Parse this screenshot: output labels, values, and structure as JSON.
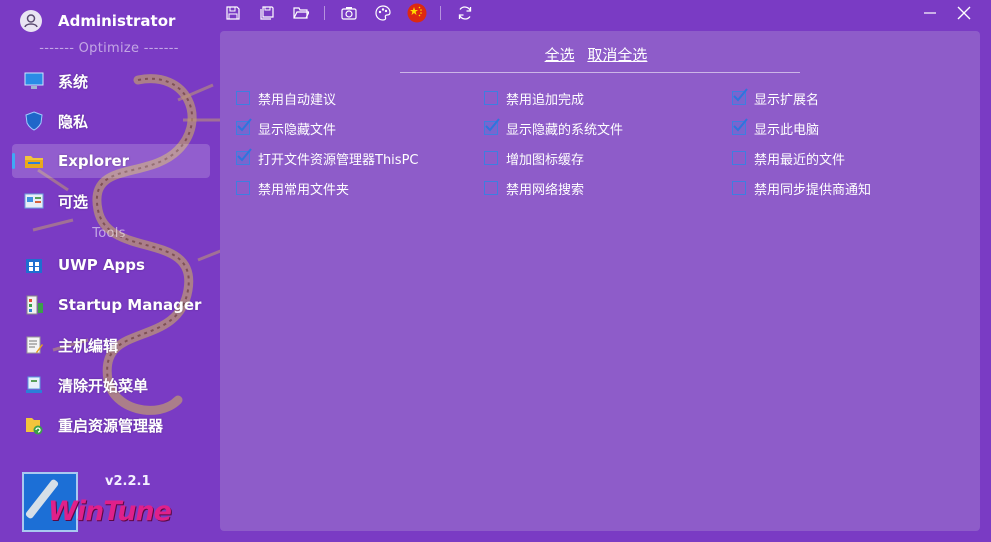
{
  "user": {
    "name": "Administrator"
  },
  "sidebar": {
    "section_optimize": "------- Optimize -------",
    "section_tools": "Tools",
    "items": [
      {
        "label": "系统",
        "icon": "monitor-icon"
      },
      {
        "label": "隐私",
        "icon": "shield-icon"
      },
      {
        "label": "Explorer",
        "icon": "folder-icon",
        "active": true
      },
      {
        "label": "可选",
        "icon": "control-panel-icon"
      },
      {
        "label": "UWP Apps",
        "icon": "windows-store-icon"
      },
      {
        "label": "Startup Manager",
        "icon": "startup-icon"
      },
      {
        "label": "主机编辑",
        "icon": "hosts-edit-icon"
      },
      {
        "label": "清除开始菜单",
        "icon": "start-menu-icon"
      },
      {
        "label": "重启资源管理器",
        "icon": "restart-explorer-icon"
      }
    ],
    "version": "v2.2.1",
    "logo_text": "WinTune"
  },
  "toolbar": {
    "icons": [
      "save-icon",
      "save-all-icon",
      "open-folder-icon",
      "camera-icon",
      "palette-icon",
      "china-flag-icon",
      "refresh-icon"
    ]
  },
  "window": {
    "minimize": "minimize-icon",
    "close": "close-icon"
  },
  "main": {
    "select_all": "全选",
    "deselect_all": "取消全选",
    "options": [
      {
        "label": "禁用自动建议",
        "checked": false
      },
      {
        "label": "禁用追加完成",
        "checked": false
      },
      {
        "label": "显示扩展名",
        "checked": true
      },
      {
        "label": "显示隐藏文件",
        "checked": true
      },
      {
        "label": "显示隐藏的系统文件",
        "checked": true
      },
      {
        "label": "显示此电脑",
        "checked": true
      },
      {
        "label": "打开文件资源管理器ThisPC",
        "checked": true
      },
      {
        "label": "增加图标缓存",
        "checked": false
      },
      {
        "label": "禁用最近的文件",
        "checked": false
      },
      {
        "label": "禁用常用文件夹",
        "checked": false
      },
      {
        "label": "禁用网络搜索",
        "checked": false
      },
      {
        "label": "禁用同步提供商通知",
        "checked": false
      }
    ]
  },
  "colors": {
    "background": "#7a3bc4",
    "panel": "#8e5cc9",
    "accent": "#3f7ee0"
  }
}
